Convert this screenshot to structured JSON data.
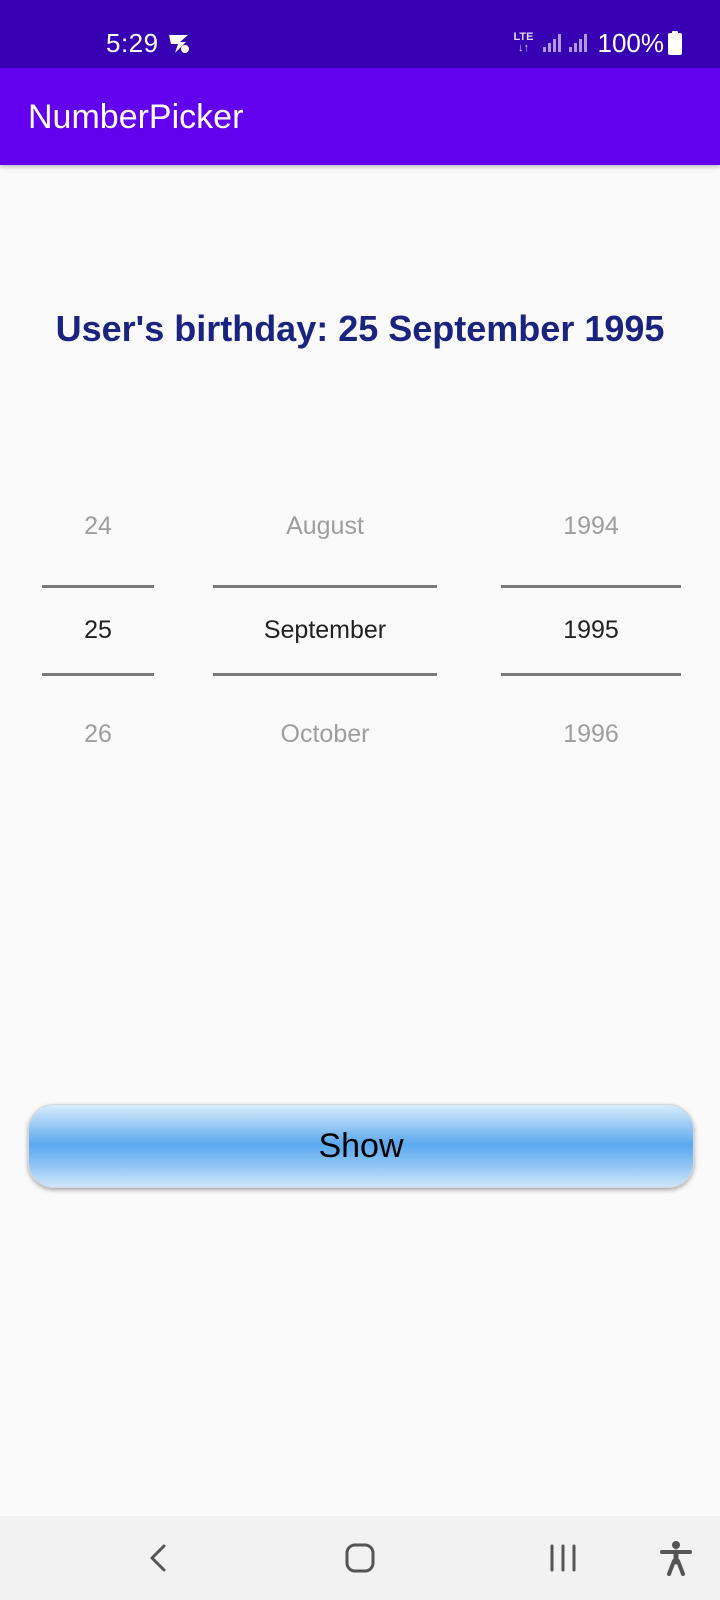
{
  "status_bar": {
    "time": "5:29",
    "network": "LTE",
    "battery": "100%",
    "icons": [
      "app-notification-icon",
      "lte-icon",
      "signal-icon",
      "signal-icon",
      "battery-icon"
    ]
  },
  "app_bar": {
    "title": "NumberPicker",
    "color": "#6200ee"
  },
  "birthday_text": "User's birthday: 25 September 1995",
  "pickers": {
    "day": {
      "prev": "24",
      "selected": "25",
      "next": "26"
    },
    "month": {
      "prev": "August",
      "selected": "September",
      "next": "October"
    },
    "year": {
      "prev": "1994",
      "selected": "1995",
      "next": "1996"
    }
  },
  "show_button": {
    "label": "Show"
  },
  "nav_bar": {
    "icons": [
      "back-icon",
      "home-icon",
      "recents-icon",
      "accessibility-icon"
    ]
  },
  "colors": {
    "status_bar": "#3700b3",
    "app_bar": "#6200ee",
    "birthday_text": "#1a237e",
    "background": "#fafafa"
  }
}
